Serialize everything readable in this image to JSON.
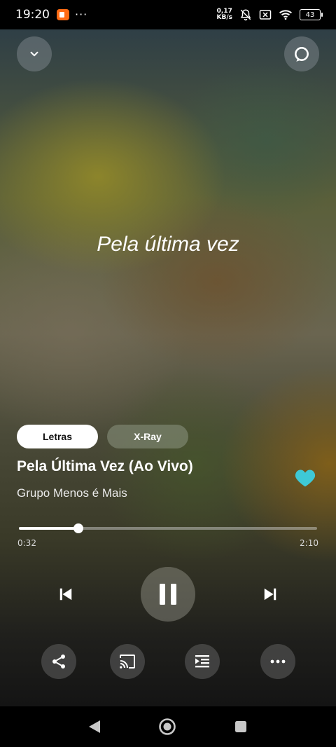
{
  "status_bar": {
    "time": "19:20",
    "dots": "···",
    "speed_value": "0,17",
    "speed_unit": "KB/s",
    "battery": "43",
    "icons": [
      "app-notification-icon",
      "mute-bell-icon",
      "no-sim-icon",
      "wifi-icon",
      "battery-icon"
    ]
  },
  "player": {
    "current_lyric": "Pela última vez",
    "tabs": [
      {
        "label": "Letras",
        "active": true
      },
      {
        "label": "X-Ray",
        "active": false
      }
    ],
    "song_title": "Pela Última Vez (Ao Vivo)",
    "artist": "Grupo Menos é Mais",
    "liked": true,
    "accent_color": "#3ec9d6",
    "progress": {
      "elapsed": "0:32",
      "total": "2:10",
      "fraction": 0.2
    },
    "state": "playing"
  },
  "colors": {
    "heart": "#3ec9d6",
    "tab_active_bg": "#ffffff",
    "app_icon": "#ff6a13"
  }
}
